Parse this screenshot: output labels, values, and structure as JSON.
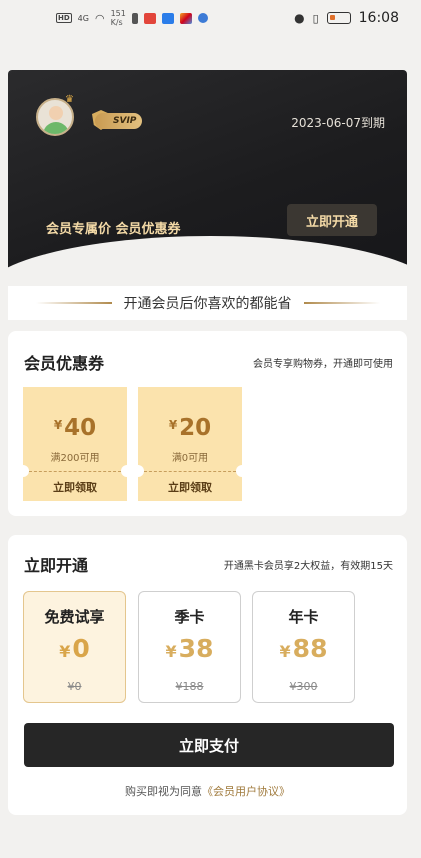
{
  "status_bar": {
    "network": "4G",
    "speed_value": "151",
    "speed_unit": "K/s",
    "time": "16:08"
  },
  "header": {
    "badge": "SVIP",
    "expire_text": "2023-06-07到期",
    "tagline": "会员专属价 会员优惠券",
    "open_button": "立即开通"
  },
  "saver_banner": "开通会员后你喜欢的都能省",
  "coupons_section": {
    "title": "会员优惠券",
    "subtitle": "会员专享购物券，开通即可使用",
    "coupons": [
      {
        "currency": "¥",
        "amount": "40",
        "condition": "满200可用",
        "action": "立即领取"
      },
      {
        "currency": "¥",
        "amount": "20",
        "condition": "满0可用",
        "action": "立即领取"
      }
    ]
  },
  "open_section": {
    "title": "立即开通",
    "subtitle": "开通黑卡会员享2大权益，有效期15天",
    "plans": [
      {
        "name": "免费试享",
        "currency": "¥",
        "price": "0",
        "original": "¥0",
        "selected": true
      },
      {
        "name": "季卡",
        "currency": "¥",
        "price": "38",
        "original": "¥188",
        "selected": false
      },
      {
        "name": "年卡",
        "currency": "¥",
        "price": "88",
        "original": "¥300",
        "selected": false
      }
    ],
    "pay_button": "立即支付",
    "agreement_prefix": "购买即视为同意",
    "agreement_link": "《会员用户协议》"
  },
  "colors": {
    "gold": "#d9a54a",
    "coupon_bg": "#fbe3ad",
    "dark": "#262626"
  }
}
